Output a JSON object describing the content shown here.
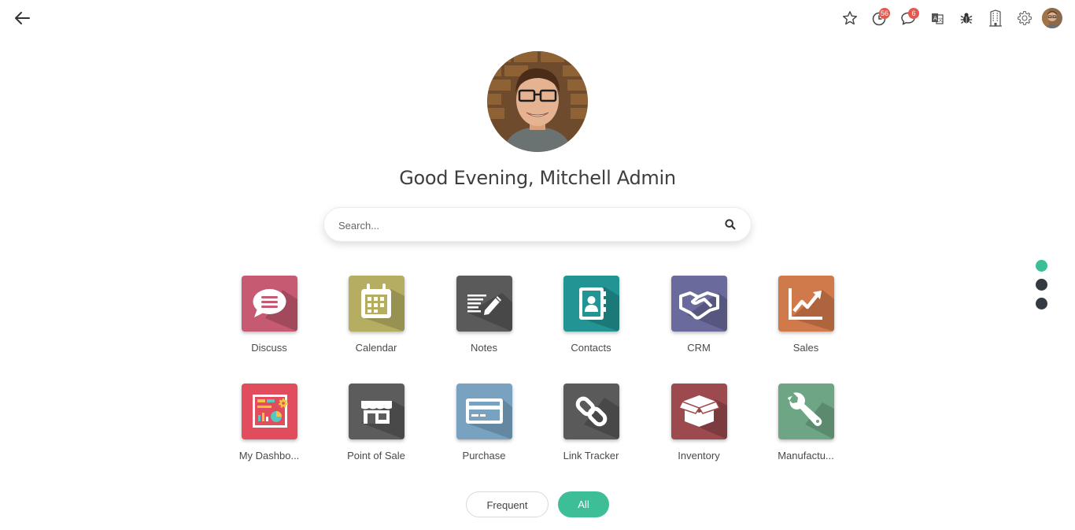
{
  "topbar": {
    "back_label": "back",
    "activity_badge": "56",
    "messages_badge": "6"
  },
  "greeting": {
    "text": "Good Evening, Mitchell Admin"
  },
  "search": {
    "placeholder": "Search..."
  },
  "apps": [
    {
      "label": "Discuss",
      "color": "#c65a73"
    },
    {
      "label": "Calendar",
      "color": "#b4ad62"
    },
    {
      "label": "Notes",
      "color": "#5a5a5a"
    },
    {
      "label": "Contacts",
      "color": "#229493"
    },
    {
      "label": "CRM",
      "color": "#6a6a9c"
    },
    {
      "label": "Sales",
      "color": "#d0794a"
    },
    {
      "label": "My Dashbo...",
      "color": "#e24d5e"
    },
    {
      "label": "Point of Sale",
      "color": "#5c5c5c"
    },
    {
      "label": "Purchase",
      "color": "#78a2c0"
    },
    {
      "label": "Link Tracker",
      "color": "#5a5a5a"
    },
    {
      "label": "Inventory",
      "color": "#9c4a4e"
    },
    {
      "label": "Manufactu...",
      "color": "#6ea585"
    }
  ],
  "pagination": {
    "active_color": "#3ebe96",
    "inactive_color": "#333a42"
  },
  "toggle": {
    "frequent_label": "Frequent",
    "all_label": "All",
    "active_color": "#3ebe96"
  }
}
